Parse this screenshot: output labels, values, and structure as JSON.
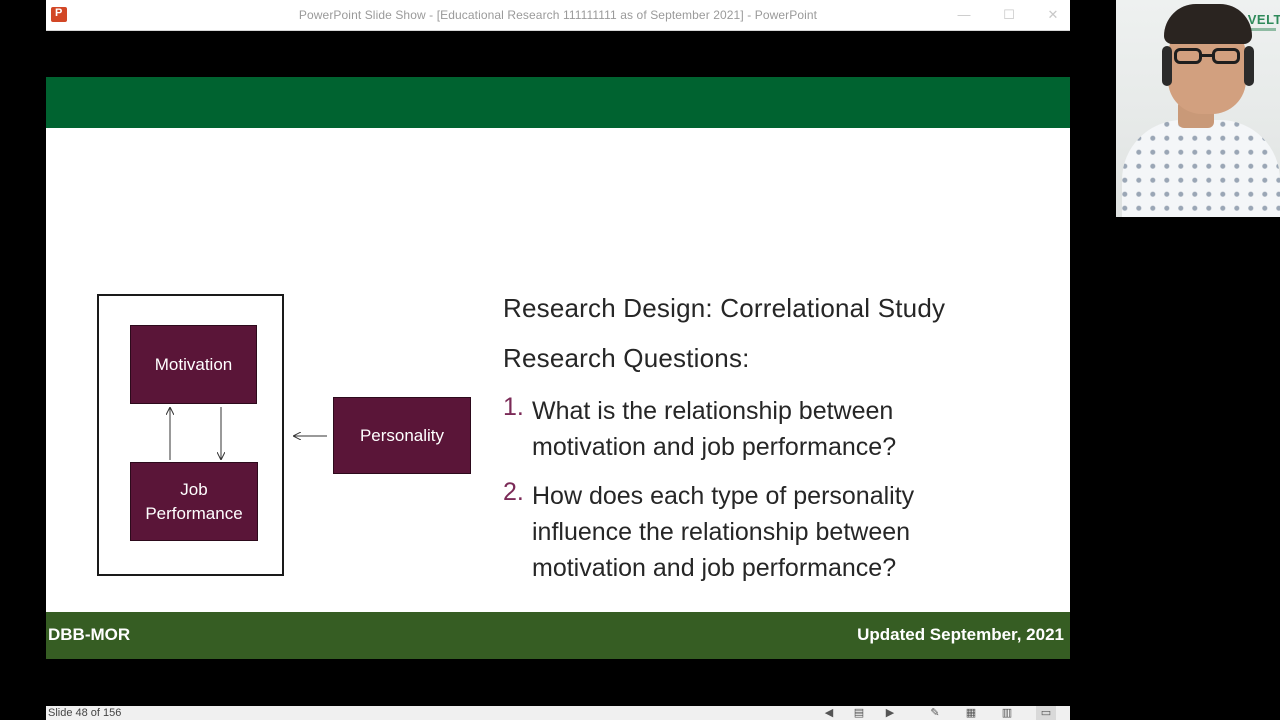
{
  "window": {
    "title": "PowerPoint Slide Show - [Educational Research 111111111 as of September 2021] - PowerPoint",
    "app_icon": "powerpoint-icon",
    "controls": {
      "minimize": "—",
      "maximize": "☐",
      "close": "✕"
    }
  },
  "webcam": {
    "logo_text": "VELT"
  },
  "slide": {
    "colors": {
      "top_bar": "#006330",
      "footer": "#365d23",
      "box_fill": "#5a1538",
      "number_accent": "#7b2a57"
    },
    "diagram": {
      "boxes": {
        "motivation": "Motivation",
        "job_performance_line1": "Job",
        "job_performance_line2": "Performance",
        "personality": "Personality"
      }
    },
    "design_line": "Research Design: Correlational Study",
    "questions_heading": "Research Questions:",
    "questions": [
      {
        "number": "1.",
        "text": "What is the relationship between motivation and job performance?"
      },
      {
        "number": "2.",
        "text": "How does each type of personality influence the relationship between motivation and job performance?"
      }
    ],
    "footer": {
      "left": "DBB-MOR",
      "right": "Updated September, 2021"
    }
  },
  "statusbar": {
    "slide_counter": "Slide 48 of 156",
    "icons": {
      "prev": "◀",
      "notes": "▤",
      "next": "▶",
      "annotate": "✎",
      "grid": "▦",
      "reading": "▥",
      "present": "▭"
    }
  }
}
